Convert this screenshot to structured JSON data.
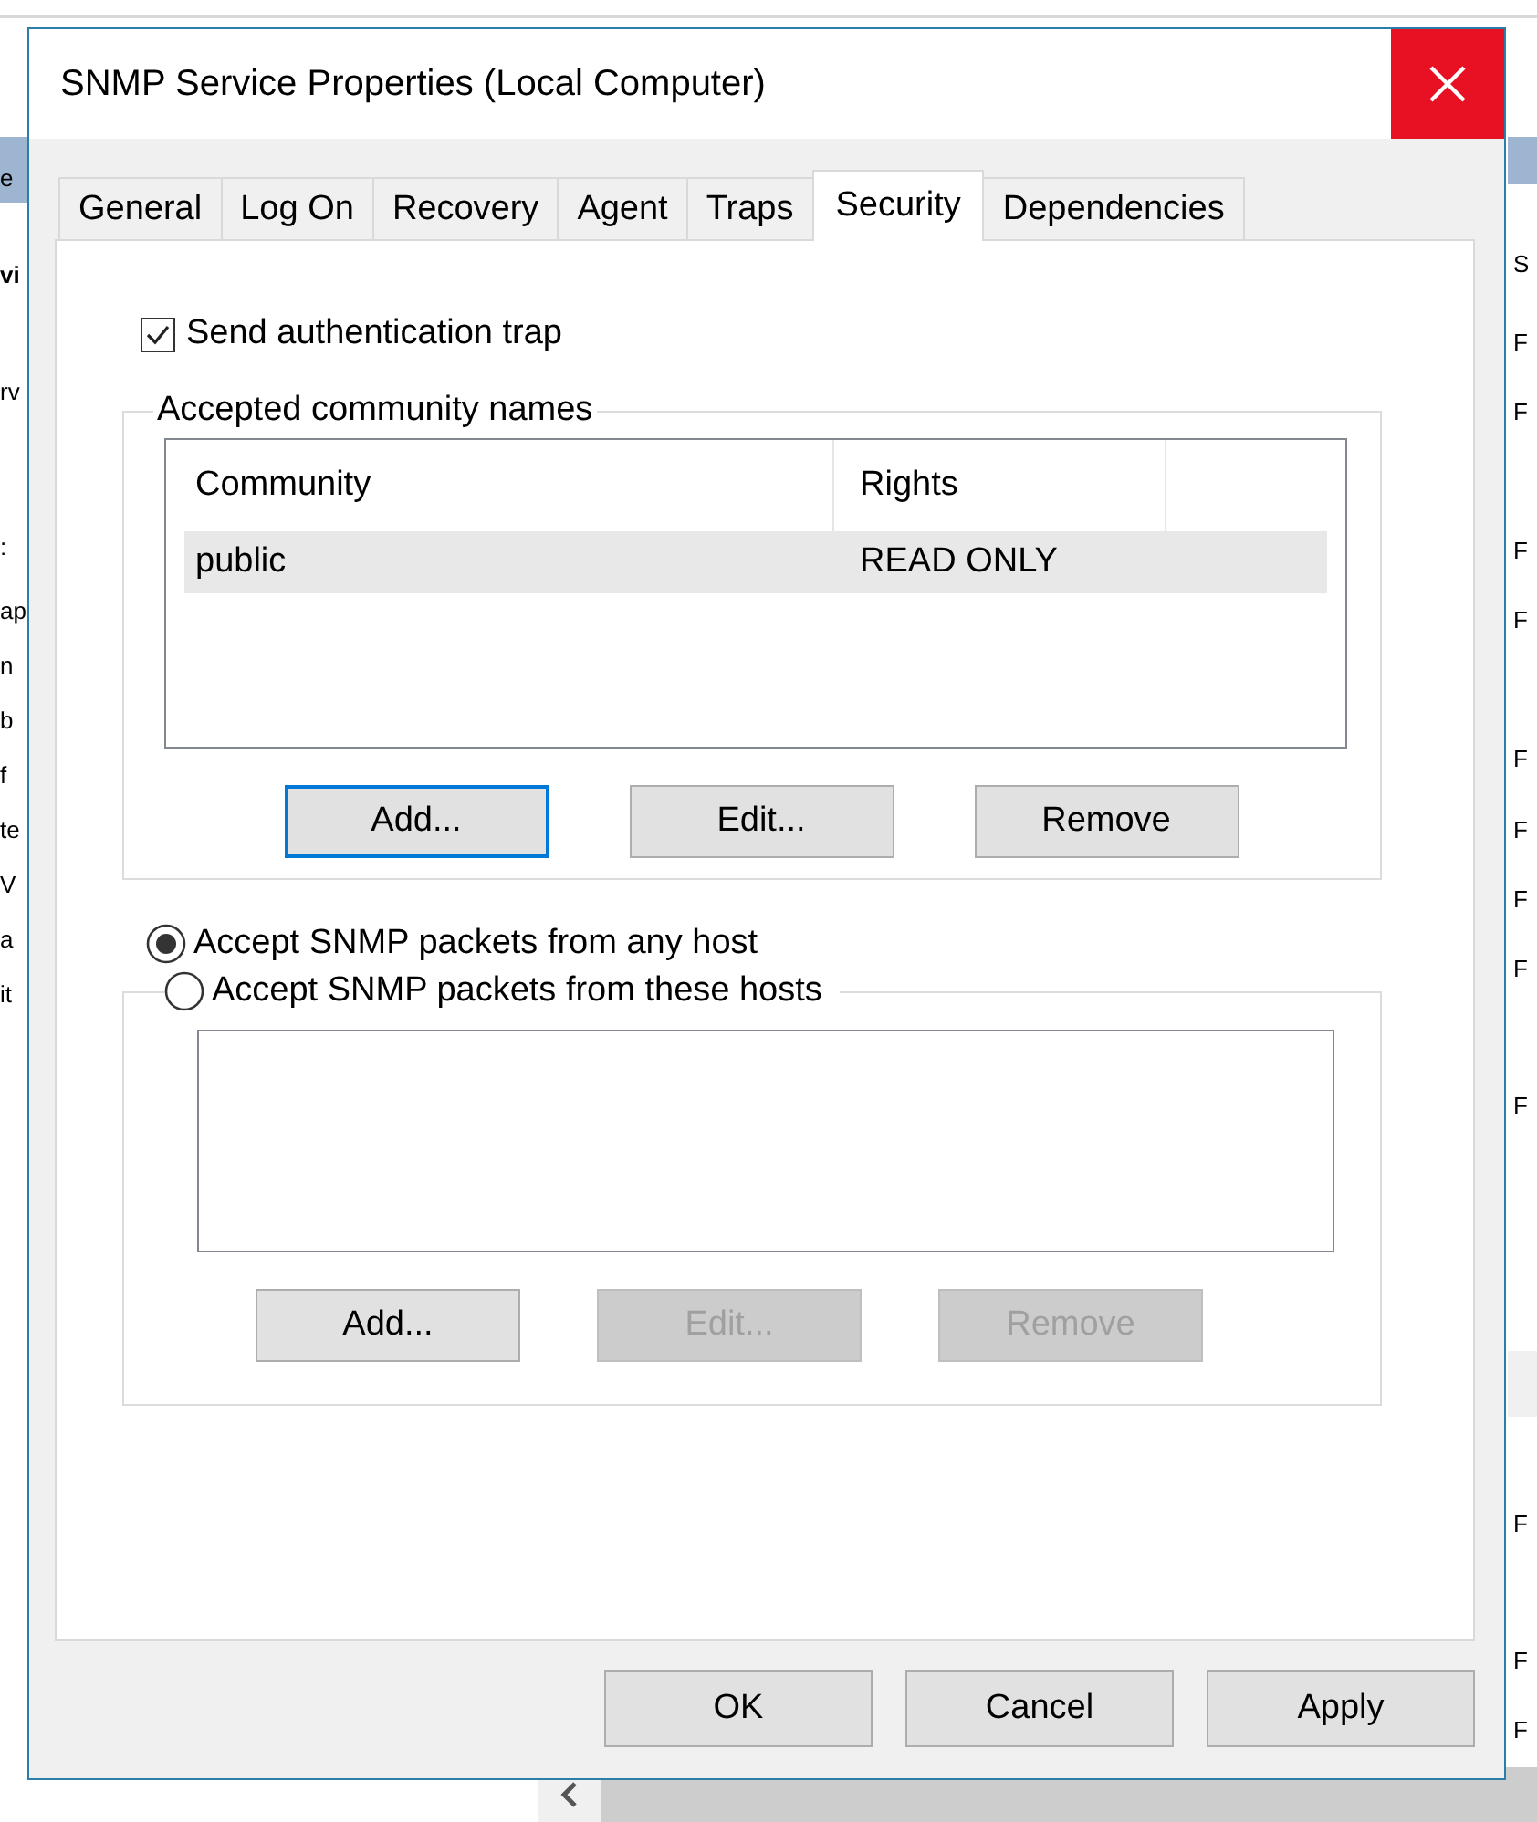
{
  "background": {
    "left_fragments": [
      {
        "text": "e",
        "bold": false
      },
      {
        "text": "vi",
        "bold": true
      },
      {
        "text": "rv",
        "bold": false
      },
      {
        "text": ":",
        "bold": false
      },
      {
        "text": "ap",
        "bold": false
      },
      {
        "text": "n",
        "bold": false
      },
      {
        "text": "b",
        "bold": false
      },
      {
        "text": "f",
        "bold": false
      },
      {
        "text": "te",
        "bold": false
      },
      {
        "text": "V",
        "bold": false
      },
      {
        "text": "a",
        "bold": false
      },
      {
        "text": "it",
        "bold": false
      }
    ],
    "right_fragments": [
      "S",
      "F",
      "F",
      "F",
      "F",
      "F",
      "F",
      "F",
      "F",
      "F",
      "F",
      "F",
      "F"
    ]
  },
  "dialog": {
    "title": "SNMP Service Properties (Local Computer)",
    "tabs": [
      {
        "label": "General",
        "selected": false
      },
      {
        "label": "Log On",
        "selected": false
      },
      {
        "label": "Recovery",
        "selected": false
      },
      {
        "label": "Agent",
        "selected": false
      },
      {
        "label": "Traps",
        "selected": false
      },
      {
        "label": "Security",
        "selected": true
      },
      {
        "label": "Dependencies",
        "selected": false
      }
    ],
    "send_authentication_trap": {
      "label": "Send authentication trap",
      "checked": true
    },
    "community_group": {
      "title": "Accepted community names",
      "columns": [
        "Community",
        "Rights"
      ],
      "rows": [
        {
          "cells": [
            "public",
            "READ ONLY"
          ],
          "selected": true
        }
      ],
      "buttons": [
        {
          "label": "Add...",
          "focused": true,
          "disabled": false
        },
        {
          "label": "Edit...",
          "focused": false,
          "disabled": false
        },
        {
          "label": "Remove",
          "focused": false,
          "disabled": false
        }
      ]
    },
    "host_options": [
      {
        "label": "Accept SNMP packets from any host",
        "selected": true
      },
      {
        "label": "Accept SNMP packets from these hosts",
        "selected": false
      }
    ],
    "hosts_group": {
      "buttons": [
        {
          "label": "Add...",
          "focused": false,
          "disabled": false
        },
        {
          "label": "Edit...",
          "focused": false,
          "disabled": true
        },
        {
          "label": "Remove",
          "focused": false,
          "disabled": true
        }
      ]
    },
    "footer_buttons": [
      {
        "label": "OK",
        "focused": false,
        "disabled": false
      },
      {
        "label": "Cancel",
        "focused": false,
        "disabled": false
      },
      {
        "label": "Apply",
        "focused": false,
        "disabled": false
      }
    ]
  }
}
